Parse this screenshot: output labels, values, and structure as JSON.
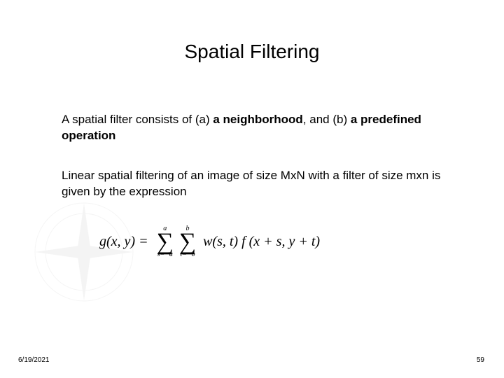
{
  "title": "Spatial Filtering",
  "para1": {
    "t1": "A spatial filter consists of (a) ",
    "b1": "a neighborhood",
    "t2": ", and (b) ",
    "b2": "a predefined operation"
  },
  "para2": "Linear spatial filtering of an image of size MxN with a filter of size mxn is given by the expression",
  "formula": {
    "lhs": "g(x, y) = ",
    "sum1_top": "a",
    "sum1_bot": "s=−a",
    "sum2_top": "b",
    "sum2_bot": "t=−b",
    "rhs": "w(s, t) f (x + s, y + t)"
  },
  "footer": {
    "date": "6/19/2021",
    "page": "59"
  }
}
